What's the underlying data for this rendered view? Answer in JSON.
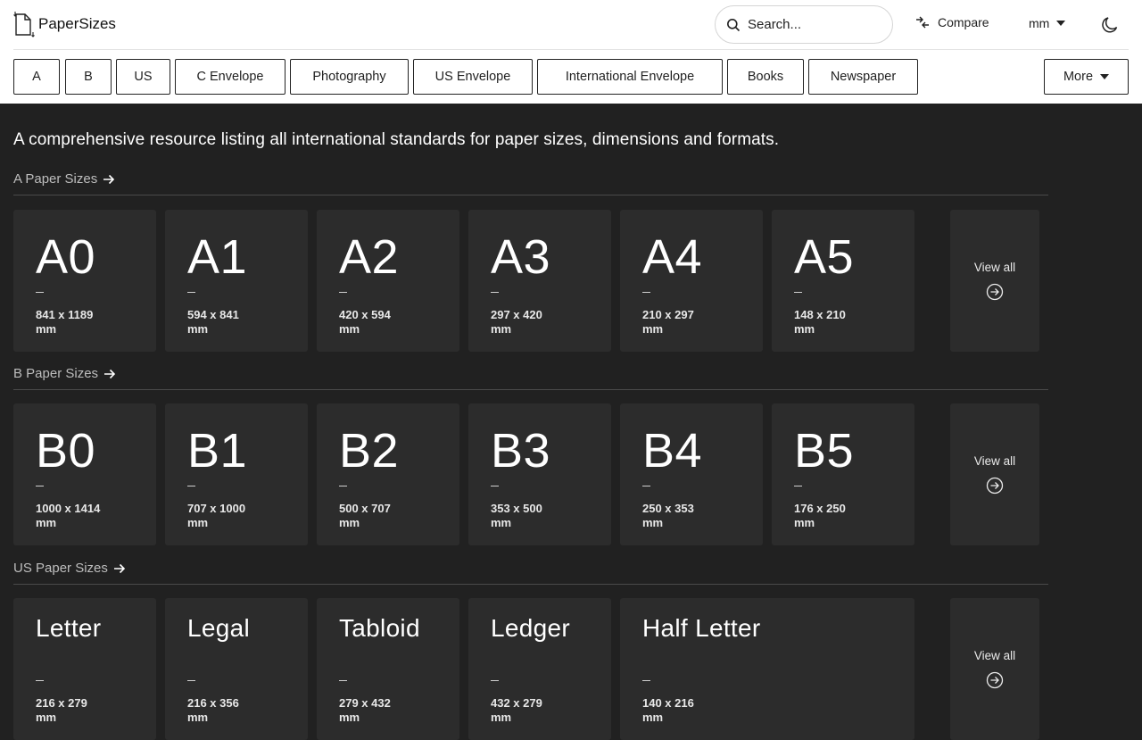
{
  "app": {
    "title": "PaperSizes"
  },
  "search": {
    "placeholder": "Search..."
  },
  "toolbar": {
    "compare_label": "Compare",
    "unit_label": "mm"
  },
  "categories": [
    "A",
    "B",
    "US",
    "C Envelope",
    "Photography",
    "US Envelope",
    "International Envelope",
    "Books",
    "Newspaper"
  ],
  "more_label": "More",
  "intro": "A comprehensive resource listing all international standards for paper sizes, dimensions and formats.",
  "view_all_label": "View all",
  "sections": [
    {
      "title": "A Paper Sizes",
      "cards": [
        {
          "name": "A0",
          "dims": "841 x 1189",
          "unit": "mm"
        },
        {
          "name": "A1",
          "dims": "594 x 841",
          "unit": "mm"
        },
        {
          "name": "A2",
          "dims": "420 x 594",
          "unit": "mm"
        },
        {
          "name": "A3",
          "dims": "297 x 420",
          "unit": "mm"
        },
        {
          "name": "A4",
          "dims": "210 x 297",
          "unit": "mm"
        },
        {
          "name": "A5",
          "dims": "148 x 210",
          "unit": "mm"
        }
      ]
    },
    {
      "title": "B Paper Sizes",
      "cards": [
        {
          "name": "B0",
          "dims": "1000 x 1414",
          "unit": "mm"
        },
        {
          "name": "B1",
          "dims": "707 x 1000",
          "unit": "mm"
        },
        {
          "name": "B2",
          "dims": "500 x 707",
          "unit": "mm"
        },
        {
          "name": "B3",
          "dims": "353 x 500",
          "unit": "mm"
        },
        {
          "name": "B4",
          "dims": "250 x 353",
          "unit": "mm"
        },
        {
          "name": "B5",
          "dims": "176 x 250",
          "unit": "mm"
        }
      ]
    },
    {
      "title": "US Paper Sizes",
      "cards": [
        {
          "name": "Letter",
          "dims": "216 x 279",
          "unit": "mm"
        },
        {
          "name": "Legal",
          "dims": "216 x 356",
          "unit": "mm"
        },
        {
          "name": "Tabloid",
          "dims": "279 x 432",
          "unit": "mm"
        },
        {
          "name": "Ledger",
          "dims": "432 x 279",
          "unit": "mm"
        },
        {
          "name": "Half Letter",
          "dims": "140 x 216",
          "unit": "mm"
        }
      ]
    }
  ]
}
